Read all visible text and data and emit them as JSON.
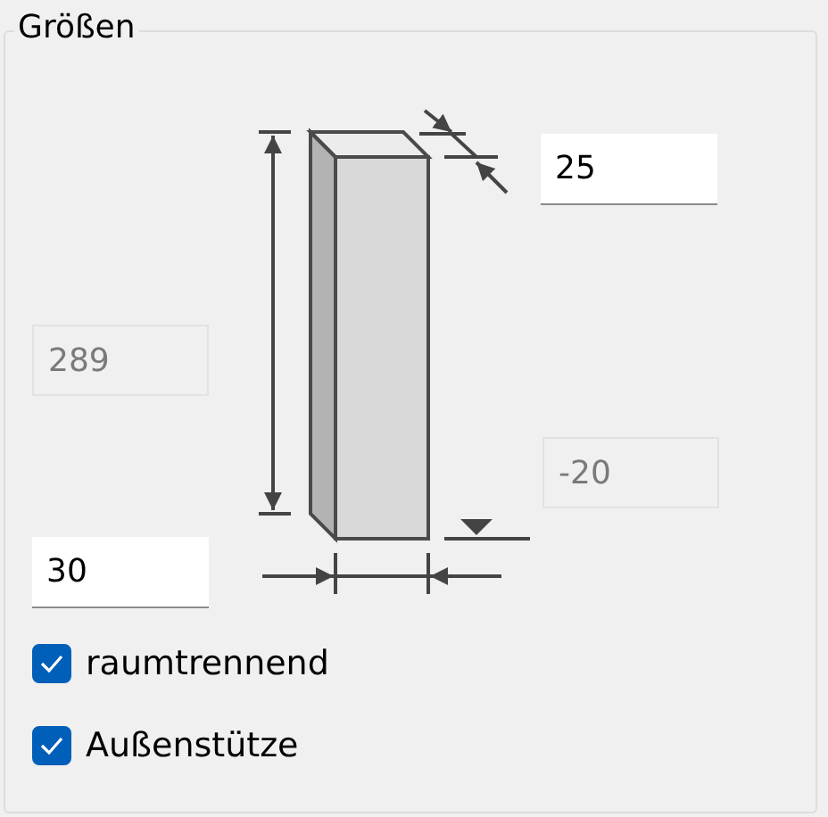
{
  "group": {
    "title": "Größen"
  },
  "fields": [
    {
      "value": "25",
      "disabled": false
    },
    {
      "value": "289",
      "disabled": true
    },
    {
      "value": "-20",
      "disabled": true
    },
    {
      "value": "30",
      "disabled": false
    }
  ],
  "checkboxes": [
    {
      "label": "raumtrennend",
      "checked": true
    },
    {
      "label": "Außenstütze",
      "checked": true
    }
  ]
}
